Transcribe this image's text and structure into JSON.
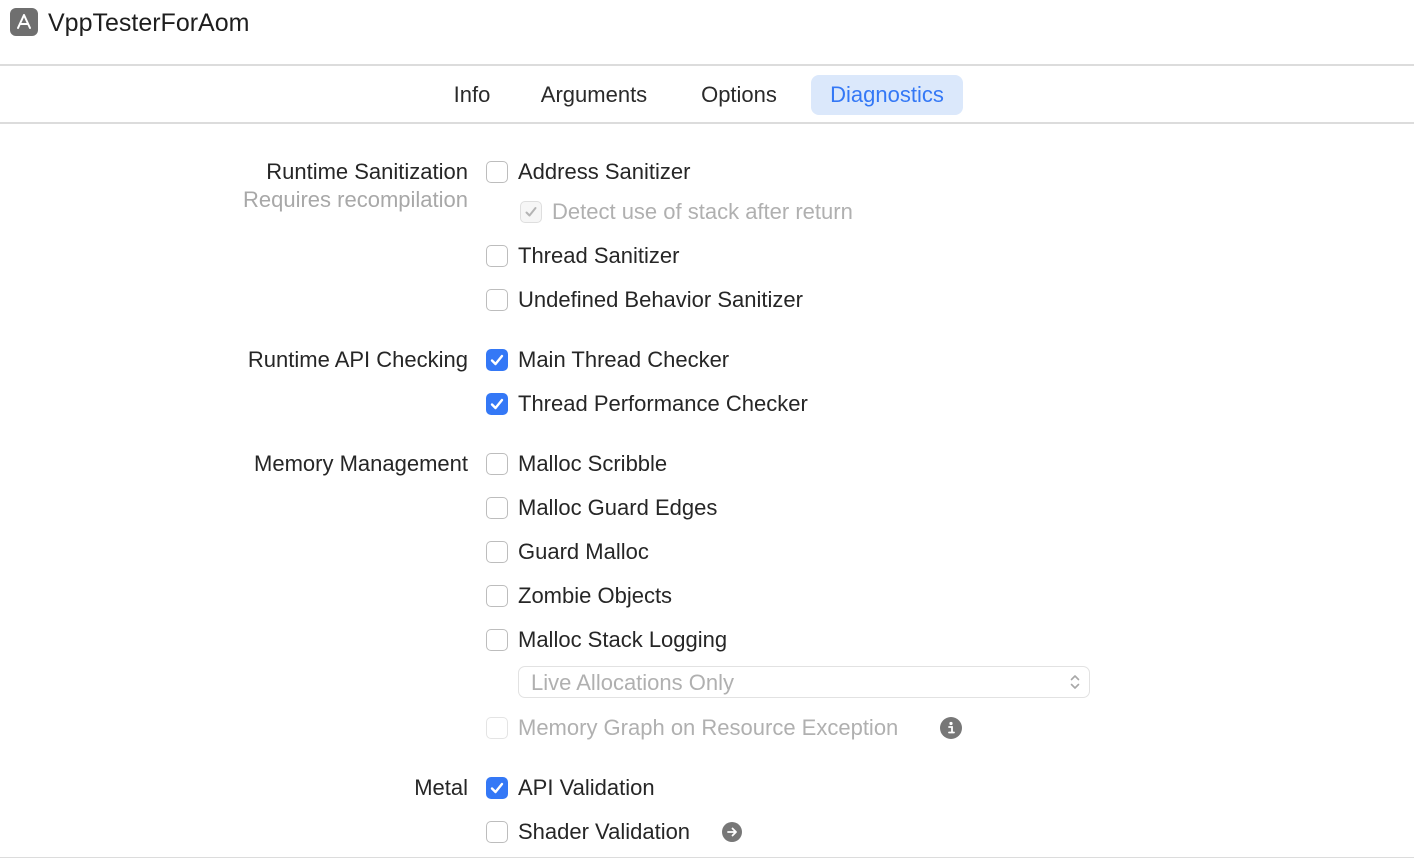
{
  "window": {
    "title": "VppTesterForAom",
    "app_icon": "app-store-icon"
  },
  "tabs": [
    {
      "label": "Info",
      "selected": false
    },
    {
      "label": "Arguments",
      "selected": false
    },
    {
      "label": "Options",
      "selected": false
    },
    {
      "label": "Diagnostics",
      "selected": true
    }
  ],
  "accent_color": "#3478f6",
  "sections": {
    "runtime_sanitization": {
      "label": "Runtime Sanitization",
      "sublabel": "Requires recompilation",
      "options": [
        {
          "label": "Address Sanitizer",
          "checked": false,
          "enabled": true
        },
        {
          "label": "Detect use of stack after return",
          "checked": true,
          "enabled": false
        },
        {
          "label": "Thread Sanitizer",
          "checked": false,
          "enabled": true
        },
        {
          "label": "Undefined Behavior Sanitizer",
          "checked": false,
          "enabled": true
        }
      ]
    },
    "runtime_api_checking": {
      "label": "Runtime API Checking",
      "options": [
        {
          "label": "Main Thread Checker",
          "checked": true,
          "enabled": true
        },
        {
          "label": "Thread Performance Checker",
          "checked": true,
          "enabled": true
        }
      ]
    },
    "memory_management": {
      "label": "Memory Management",
      "options": [
        {
          "label": "Malloc Scribble",
          "checked": false,
          "enabled": true
        },
        {
          "label": "Malloc Guard Edges",
          "checked": false,
          "enabled": true
        },
        {
          "label": "Guard Malloc",
          "checked": false,
          "enabled": true
        },
        {
          "label": "Zombie Objects",
          "checked": false,
          "enabled": true
        },
        {
          "label": "Malloc Stack Logging",
          "checked": false,
          "enabled": true
        },
        {
          "label": "Memory Graph on Resource Exception",
          "checked": false,
          "enabled": false
        }
      ],
      "stack_logging_popup": {
        "value": "Live Allocations Only",
        "enabled": false
      }
    },
    "metal": {
      "label": "Metal",
      "options": [
        {
          "label": "API Validation",
          "checked": true,
          "enabled": true
        },
        {
          "label": "Shader Validation",
          "checked": false,
          "enabled": true
        }
      ]
    }
  }
}
